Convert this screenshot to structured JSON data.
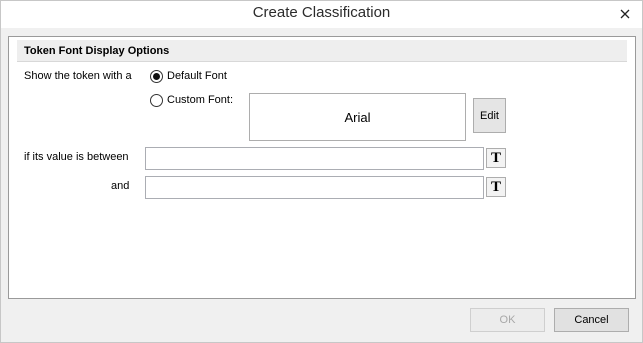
{
  "window": {
    "title": "Create Classification",
    "close_icon": "close-icon"
  },
  "group": {
    "title": "Token Font Display Options"
  },
  "font_options": {
    "show_label": "Show the token with a",
    "default_font_label": "Default Font",
    "custom_font_label": "Custom Font:",
    "selected": "default",
    "preview_font_name": "Arial",
    "edit_label": "Edit"
  },
  "range": {
    "between_label": "if its value is between",
    "and_label": "and",
    "lower_value": "",
    "upper_value": "",
    "token_button_label": "T"
  },
  "footer": {
    "ok_label": "OK",
    "ok_enabled": false,
    "cancel_label": "Cancel"
  }
}
